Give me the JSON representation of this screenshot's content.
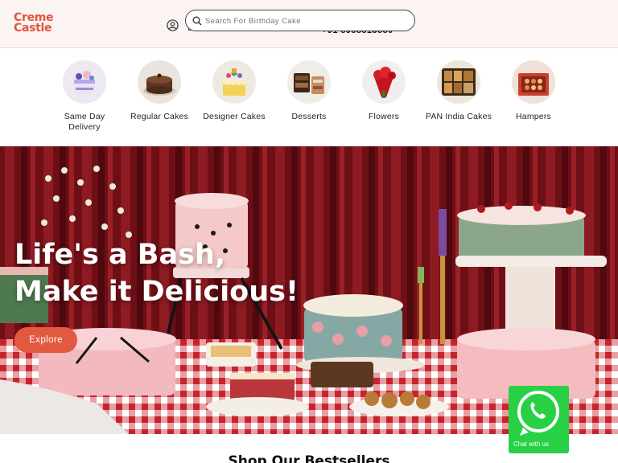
{
  "header": {
    "logo_line1": "Creme",
    "logo_line2": "Castle",
    "search_placeholder": "Search For Birthday Cake",
    "phone": "+91 8988813880",
    "accent": "#e0553a"
  },
  "categories": [
    {
      "label": "Same Day Delivery",
      "icon": "same-day-cake"
    },
    {
      "label": "Regular Cakes",
      "icon": "chocolate-cake"
    },
    {
      "label": "Designer Cakes",
      "icon": "drip-cake"
    },
    {
      "label": "Desserts",
      "icon": "dessert-box"
    },
    {
      "label": "Flowers",
      "icon": "rose-bouquet"
    },
    {
      "label": "PAN India Cakes",
      "icon": "pastry-tray"
    },
    {
      "label": "Hampers",
      "icon": "gift-hamper"
    }
  ],
  "hero": {
    "line1": "Life's a Bash,",
    "line2": "Make it Delicious!",
    "cta": "Explore",
    "cta_color": "#e2593f"
  },
  "bestsellers_title": "Shop Our Bestsellers",
  "whatsapp": {
    "label": "Chat with us",
    "color": "#27d045"
  }
}
